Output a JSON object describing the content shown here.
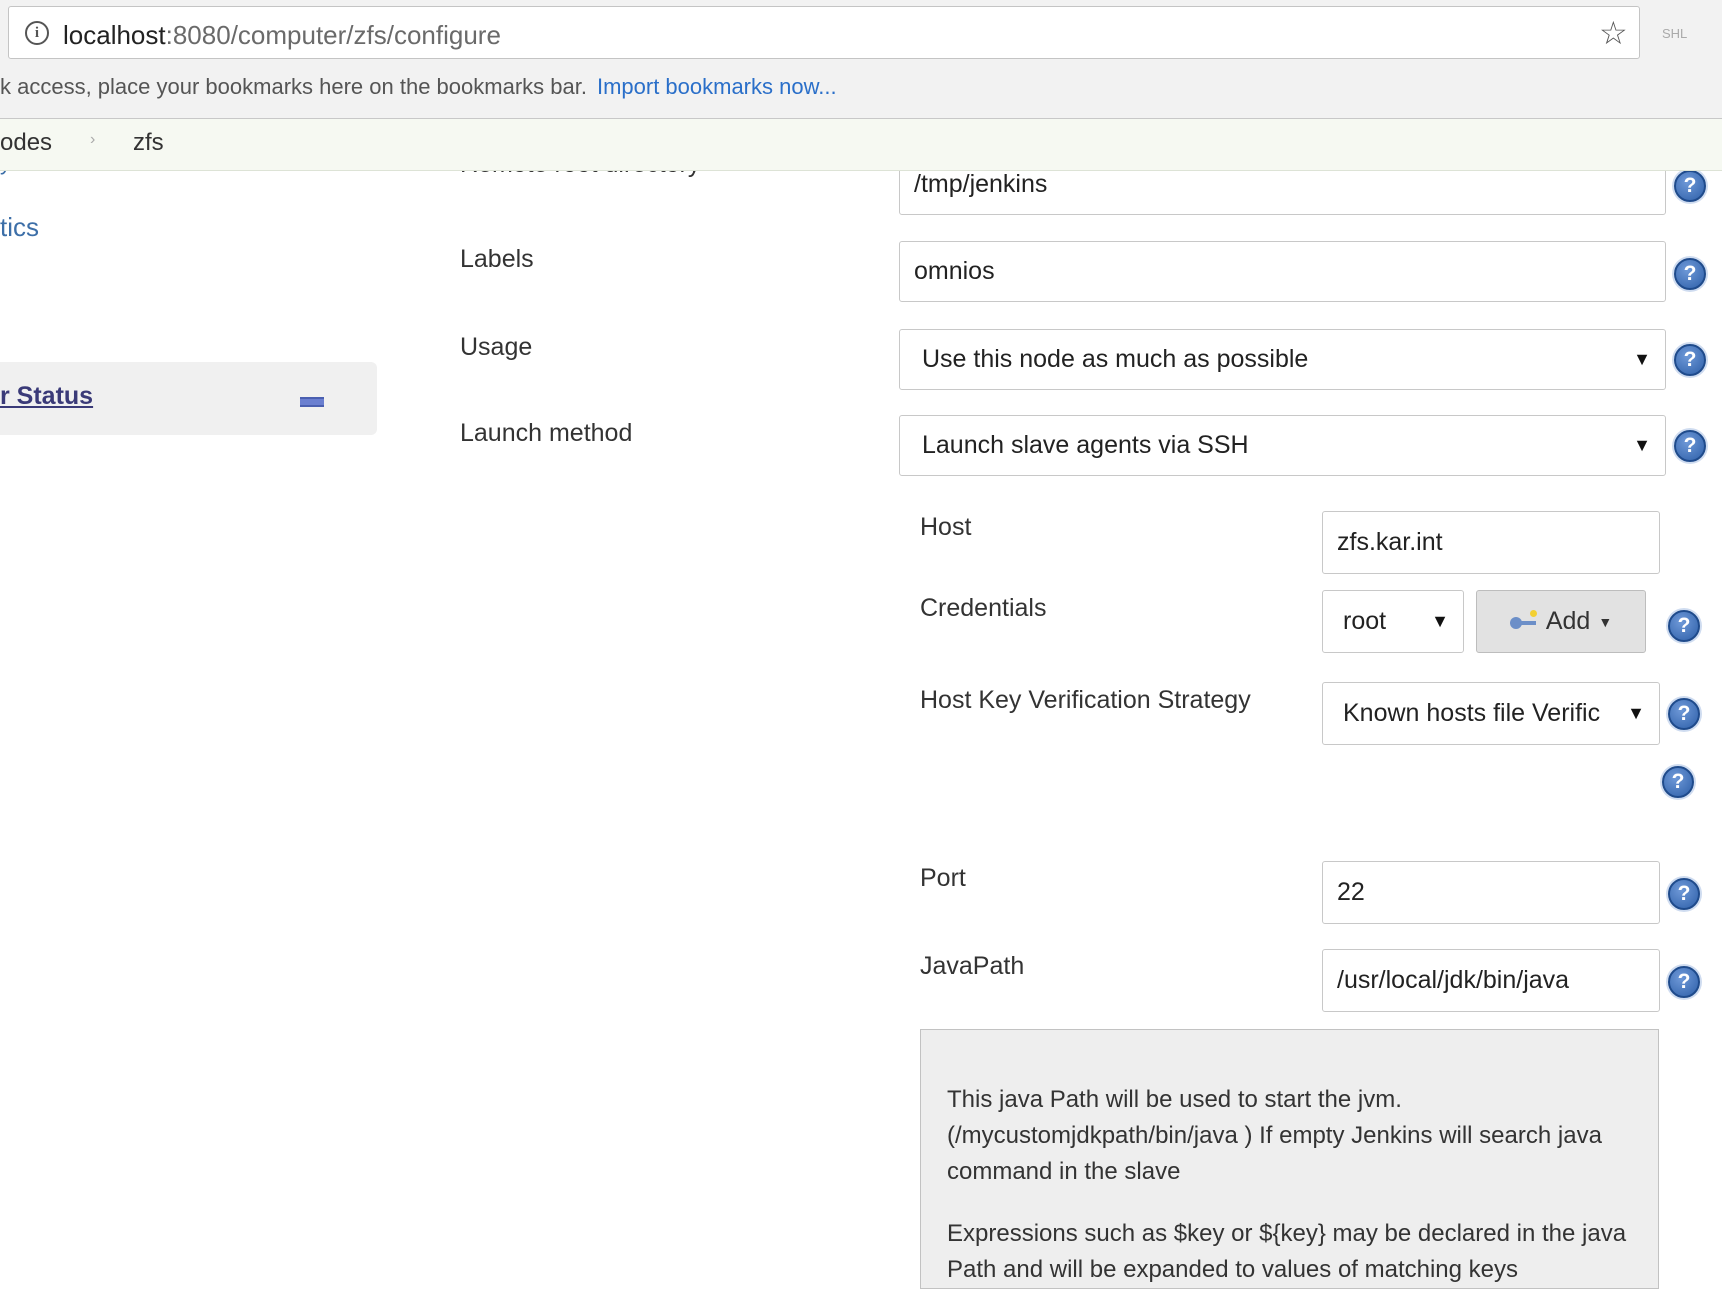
{
  "browser": {
    "url_host": "localhost",
    "url_path": ":8080/computer/zfs/configure",
    "bookmarks_prompt": "k access, place your bookmarks here on the bookmarks bar.",
    "import_link": "Import bookmarks now...",
    "extension_label": "SHL"
  },
  "breadcrumb": {
    "items": [
      "odes",
      "zfs"
    ],
    "separator": "›"
  },
  "sidebar": {
    "partial_item": "y",
    "statistics_label": "tics",
    "executor_status_label": "r Status"
  },
  "form": {
    "remote_root": {
      "label": "Remote root directory",
      "value": "/tmp/jenkins"
    },
    "labels": {
      "label": "Labels",
      "value": "omnios"
    },
    "usage": {
      "label": "Usage",
      "value": "Use this node as much as possible"
    },
    "launch_method": {
      "label": "Launch method",
      "value": "Launch slave agents via SSH"
    },
    "host": {
      "label": "Host",
      "value": "zfs.kar.int"
    },
    "credentials": {
      "label": "Credentials",
      "value": "root",
      "add_label": "Add"
    },
    "host_key": {
      "label": "Host Key Verification Strategy",
      "value": "Known hosts file Verific"
    },
    "port": {
      "label": "Port",
      "value": "22"
    },
    "java_path": {
      "label": "JavaPath",
      "value": "/usr/local/jdk/bin/java"
    }
  },
  "help_text": {
    "para1": "This java Path will be used to start the jvm. (/mycustomjdkpath/bin/java ) If empty Jenkins will search java command in the slave",
    "para2": "Expressions such as $key or ${key} may be declared in the java Path and will be expanded to values of matching keys"
  },
  "icons": {
    "info": "info-icon",
    "star": "bookmark-star-icon",
    "help": "help-icon",
    "key": "key-icon",
    "dropdown": "dropdown-caret-icon"
  },
  "colors": {
    "link": "#2a6fc9",
    "help_icon": "#2d5fa8",
    "executor_link": "#3a3a78"
  }
}
